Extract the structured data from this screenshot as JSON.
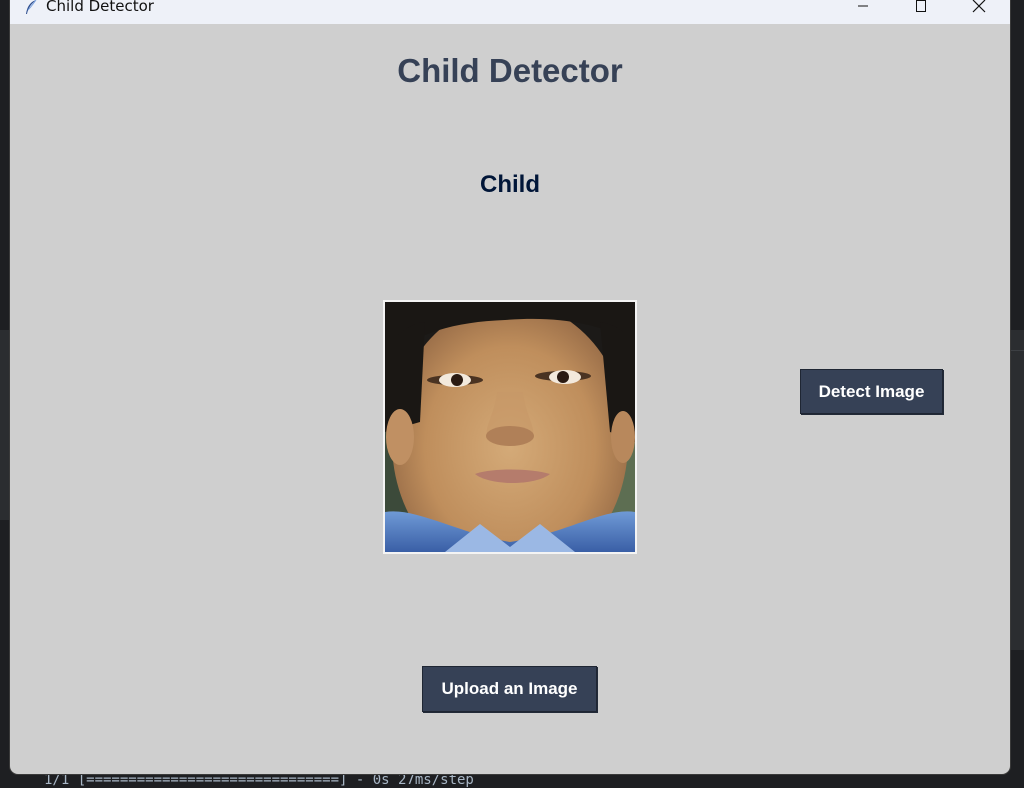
{
  "window": {
    "title": "Child Detector",
    "controls": [
      "minimize-icon",
      "maximize-icon",
      "close-icon"
    ]
  },
  "app": {
    "heading": "Child Detector",
    "result_label": "Child",
    "image_alt": "Child face photo",
    "detect_button": "Detect Image",
    "upload_button": "Upload an Image"
  },
  "background": {
    "terminal_text": "1/1 [==============================] - 0s 27ms/step"
  },
  "colors": {
    "window_bg": "#cfcfcf",
    "heading": "#364156",
    "result": "#011638",
    "button_bg": "#364156",
    "button_text": "#ffffff"
  }
}
